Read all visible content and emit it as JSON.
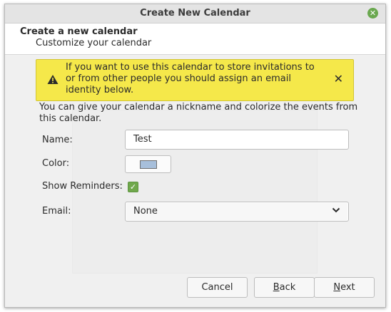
{
  "window": {
    "title": "Create New Calendar"
  },
  "header": {
    "title": "Create a new calendar",
    "subtitle": "Customize your calendar"
  },
  "warning": {
    "text": "If you want to use this calendar to store invitations to or from other people you should assign an email identity below.",
    "icon": "warning-icon",
    "color": "#f5e84a"
  },
  "description": "You can give your calendar a nickname and colorize the events from this calendar.",
  "form": {
    "name_label": "Name:",
    "name_value": "Test",
    "color_label": "Color:",
    "color_value": "#a7bfdb",
    "reminders_label": "Show Reminders:",
    "reminders_checked": true,
    "email_label": "Email:",
    "email_value": "None"
  },
  "buttons": {
    "cancel": "Cancel",
    "back_accel": "B",
    "back_rest": "ack",
    "next_accel": "N",
    "next_rest": "ext"
  },
  "accent": "#6aa84f"
}
